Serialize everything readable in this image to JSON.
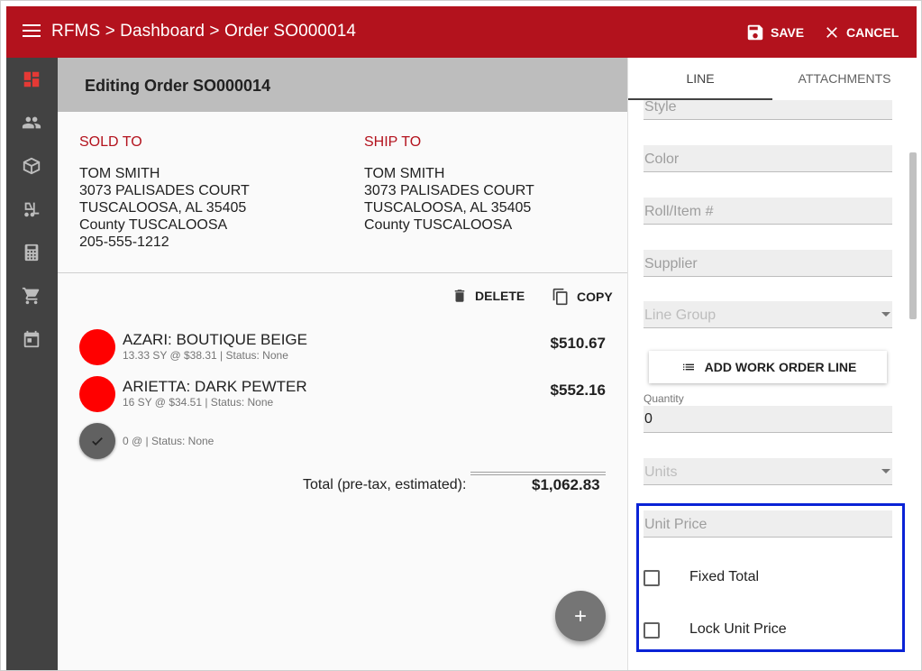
{
  "topbar": {
    "breadcrumb": "RFMS > Dashboard > Order SO000014",
    "save_label": "SAVE",
    "cancel_label": "CANCEL",
    "color": "#b3121d"
  },
  "rail": {
    "items": [
      "dashboard-icon",
      "people-icon",
      "box-icon",
      "forklift-icon",
      "calculator-icon",
      "cart-icon",
      "calendar-icon"
    ]
  },
  "header": {
    "title": "Editing Order SO000014"
  },
  "sold_to": {
    "label": "SOLD TO",
    "lines": [
      "TOM SMITH",
      "3073 PALISADES COURT",
      "TUSCALOOSA, AL 35405",
      "County TUSCALOOSA",
      "205-555-1212"
    ]
  },
  "ship_to": {
    "label": "SHIP TO",
    "lines": [
      "TOM SMITH",
      "3073 PALISADES COURT",
      "TUSCALOOSA, AL 35405",
      "County TUSCALOOSA"
    ]
  },
  "actions": {
    "delete_label": "DELETE",
    "copy_label": "COPY"
  },
  "lines": [
    {
      "name": "AZARI: BOUTIQUE BEIGE",
      "detail": "13.33 SY @ $38.31  |  Status: None",
      "price": "$510.67"
    },
    {
      "name": "ARIETTA: DARK PEWTER",
      "detail": "16 SY @ $34.51  |  Status: None",
      "price": "$552.16"
    },
    {
      "name": "",
      "detail": "0 @  |  Status: None",
      "price": ""
    }
  ],
  "totals": {
    "label": "Total (pre-tax, estimated):",
    "value": "$1,062.83"
  },
  "panel": {
    "tabs": [
      {
        "label": "LINE",
        "active": true
      },
      {
        "label": "ATTACHMENTS",
        "active": false
      }
    ],
    "fields": {
      "style": "Style",
      "color": "Color",
      "roll": "Roll/Item #",
      "supplier": "Supplier",
      "line_group": "Line Group",
      "units": "Units",
      "unit_price": "Unit Price"
    },
    "add_work_order_label": "ADD WORK ORDER LINE",
    "quantity_label": "Quantity",
    "quantity_value": "0",
    "checkboxes": {
      "fixed_total": "Fixed Total",
      "lock_unit_price": "Lock Unit Price"
    }
  },
  "colors": {
    "brand_red": "#b3121d",
    "line_dot": "#ff0000",
    "highlight": "#0a23d6"
  }
}
